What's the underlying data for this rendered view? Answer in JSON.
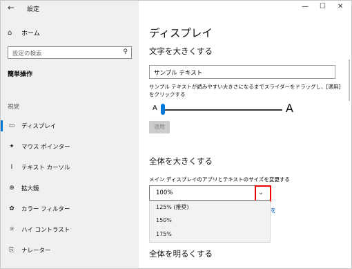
{
  "window": {
    "title": "設定"
  },
  "left": {
    "home_label": "ホーム",
    "search_placeholder": "設定の検索",
    "section_title": "簡単操作",
    "group_label": "視覚",
    "items": [
      {
        "label": "ディスプレイ"
      },
      {
        "label": "マウス ポインター"
      },
      {
        "label": "テキスト カーソル"
      },
      {
        "label": "拡大鏡"
      },
      {
        "label": "カラー フィルター"
      },
      {
        "label": "ハイ コントラスト"
      },
      {
        "label": "ナレーター"
      }
    ]
  },
  "main": {
    "page_title": "ディスプレイ",
    "text_section": {
      "heading": "文字を大きくする",
      "sample_text": "サンプル テキスト",
      "description": "サンプル テキストが読みやすい大きさになるまでスライダーをドラッグし、[適用] をクリックする",
      "slider_min_label": "A",
      "slider_max_label": "A",
      "slider_value": 0.0,
      "apply_label": "適用"
    },
    "scale_section": {
      "heading": "全体を大きくする",
      "label": "メイン ディスプレイのアプリとテキストのサイズを変更する",
      "selected": "100%",
      "options": [
        "125% (推奨)",
        "150%",
        "175%"
      ],
      "partial_link": "を"
    },
    "bright_section": {
      "heading": "全体を明るくする"
    }
  }
}
